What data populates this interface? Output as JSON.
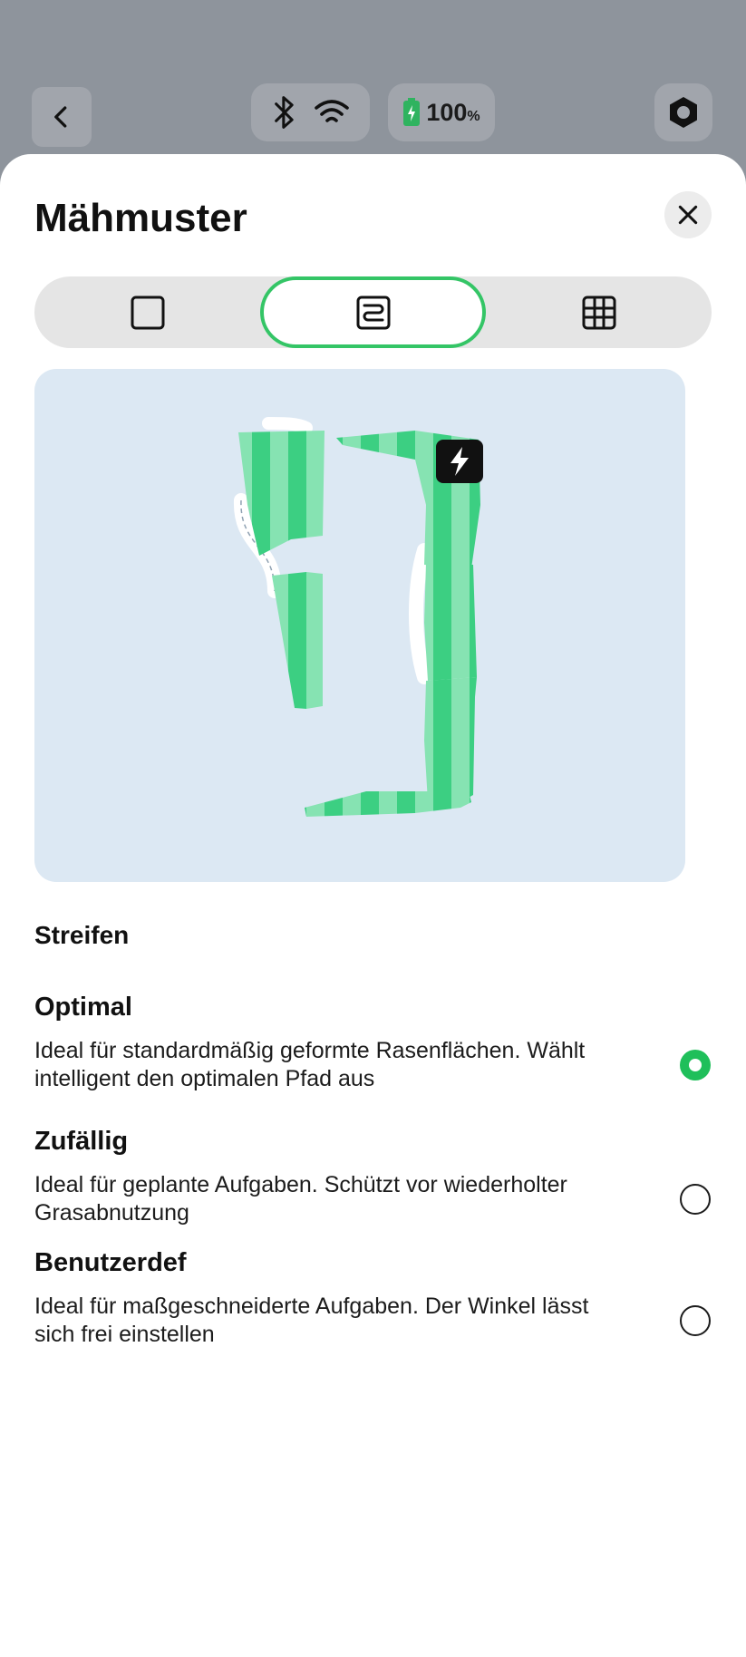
{
  "header": {
    "battery_value": "100",
    "battery_unit": "%"
  },
  "sheet": {
    "title": "Mähmuster",
    "tabs": [
      {
        "icon": "square-outline-icon",
        "selected": false
      },
      {
        "icon": "stripes-pattern-icon",
        "selected": true
      },
      {
        "icon": "grid-pattern-icon",
        "selected": false
      }
    ],
    "section_label": "Streifen",
    "options": [
      {
        "title": "Optimal",
        "description": "Ideal für standardmäßig geformte Rasenflächen. Wählt intelligent den optimalen Pfad aus",
        "selected": true
      },
      {
        "title": "Zufällig",
        "description": "Ideal für geplante Aufgaben. Schützt vor wiederholter Grasabnutzung",
        "selected": false
      },
      {
        "title": "Benutzerdef",
        "description": "Ideal für maßgeschneiderte Aufgaben. Der Winkel lässt sich frei einstellen",
        "selected": false
      }
    ]
  },
  "colors": {
    "accent": "#34c566",
    "lawn_dark": "#3ccf82",
    "lawn_light": "#86e3b2",
    "map_background": "#dce8f3"
  }
}
